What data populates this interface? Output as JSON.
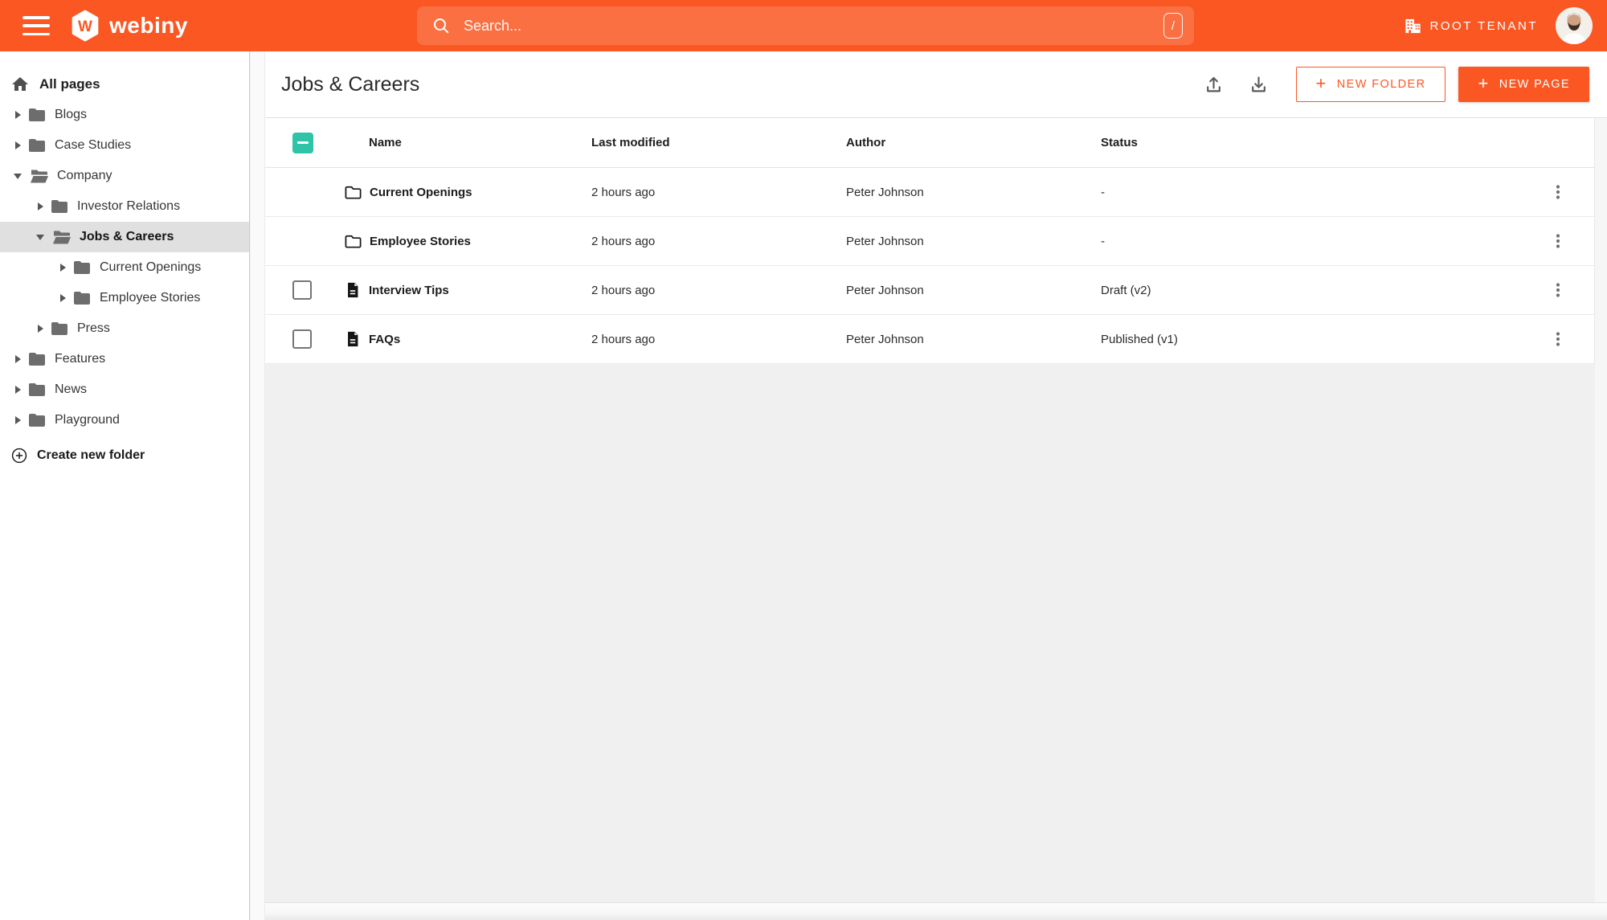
{
  "topbar": {
    "brand": "webiny",
    "logo_letter": "W",
    "search": {
      "placeholder": "Search...",
      "shortcut": "/"
    },
    "tenant": "ROOT TENANT"
  },
  "colors": {
    "accent_orange": "#fa5723",
    "checkbox_teal": "#2fc3a7",
    "selected_item_bg": "#e0e0e0",
    "content_bg": "#f0f0f0"
  },
  "icons": {
    "menu": "hamburger three bars",
    "search": "magnifier",
    "shortcut": "slash key badge",
    "tenant": "office building",
    "home": "house",
    "folder": "filled folder",
    "folder-open": "open folder",
    "chevron": "triangle expand arrow",
    "create-folder": "plus in circle",
    "import": "arrow up from tray",
    "export": "arrow down to tray",
    "folder-row": "outlined folder",
    "page-row": "document with lines",
    "row-menu": "vertical kebab dots"
  },
  "sidebar": {
    "root": "All pages",
    "create_folder": "Create new folder",
    "items": [
      {
        "label": "Blogs",
        "level": 1,
        "state": "collapsed",
        "selected": false
      },
      {
        "label": "Case Studies",
        "level": 1,
        "state": "collapsed",
        "selected": false
      },
      {
        "label": "Company",
        "level": 1,
        "state": "expanded",
        "selected": false
      },
      {
        "label": "Investor Relations",
        "level": 2,
        "state": "collapsed",
        "selected": false
      },
      {
        "label": "Jobs & Careers",
        "level": 2,
        "state": "expanded",
        "selected": true
      },
      {
        "label": "Current Openings",
        "level": 3,
        "state": "collapsed",
        "selected": false
      },
      {
        "label": "Employee Stories",
        "level": 3,
        "state": "collapsed",
        "selected": false
      },
      {
        "label": "Press",
        "level": 2,
        "state": "collapsed",
        "selected": false
      },
      {
        "label": "Features",
        "level": 1,
        "state": "collapsed",
        "selected": false
      },
      {
        "label": "News",
        "level": 1,
        "state": "collapsed",
        "selected": false
      },
      {
        "label": "Playground",
        "level": 1,
        "state": "collapsed",
        "selected": false
      }
    ]
  },
  "main": {
    "title": "Jobs & Careers",
    "buttons": {
      "new_folder": "NEW FOLDER",
      "new_page": "NEW PAGE"
    },
    "table": {
      "headers": [
        "Name",
        "Last modified",
        "Author",
        "Status"
      ],
      "rows": [
        {
          "type": "folder",
          "name": "Current Openings",
          "modified": "2 hours ago",
          "author": "Peter Johnson",
          "status": "-"
        },
        {
          "type": "folder",
          "name": "Employee Stories",
          "modified": "2 hours ago",
          "author": "Peter Johnson",
          "status": "-"
        },
        {
          "type": "page",
          "name": "Interview Tips",
          "modified": "2 hours ago",
          "author": "Peter Johnson",
          "status": "Draft (v2)"
        },
        {
          "type": "page",
          "name": "FAQs",
          "modified": "2 hours ago",
          "author": "Peter Johnson",
          "status": "Published (v1)"
        }
      ]
    }
  }
}
